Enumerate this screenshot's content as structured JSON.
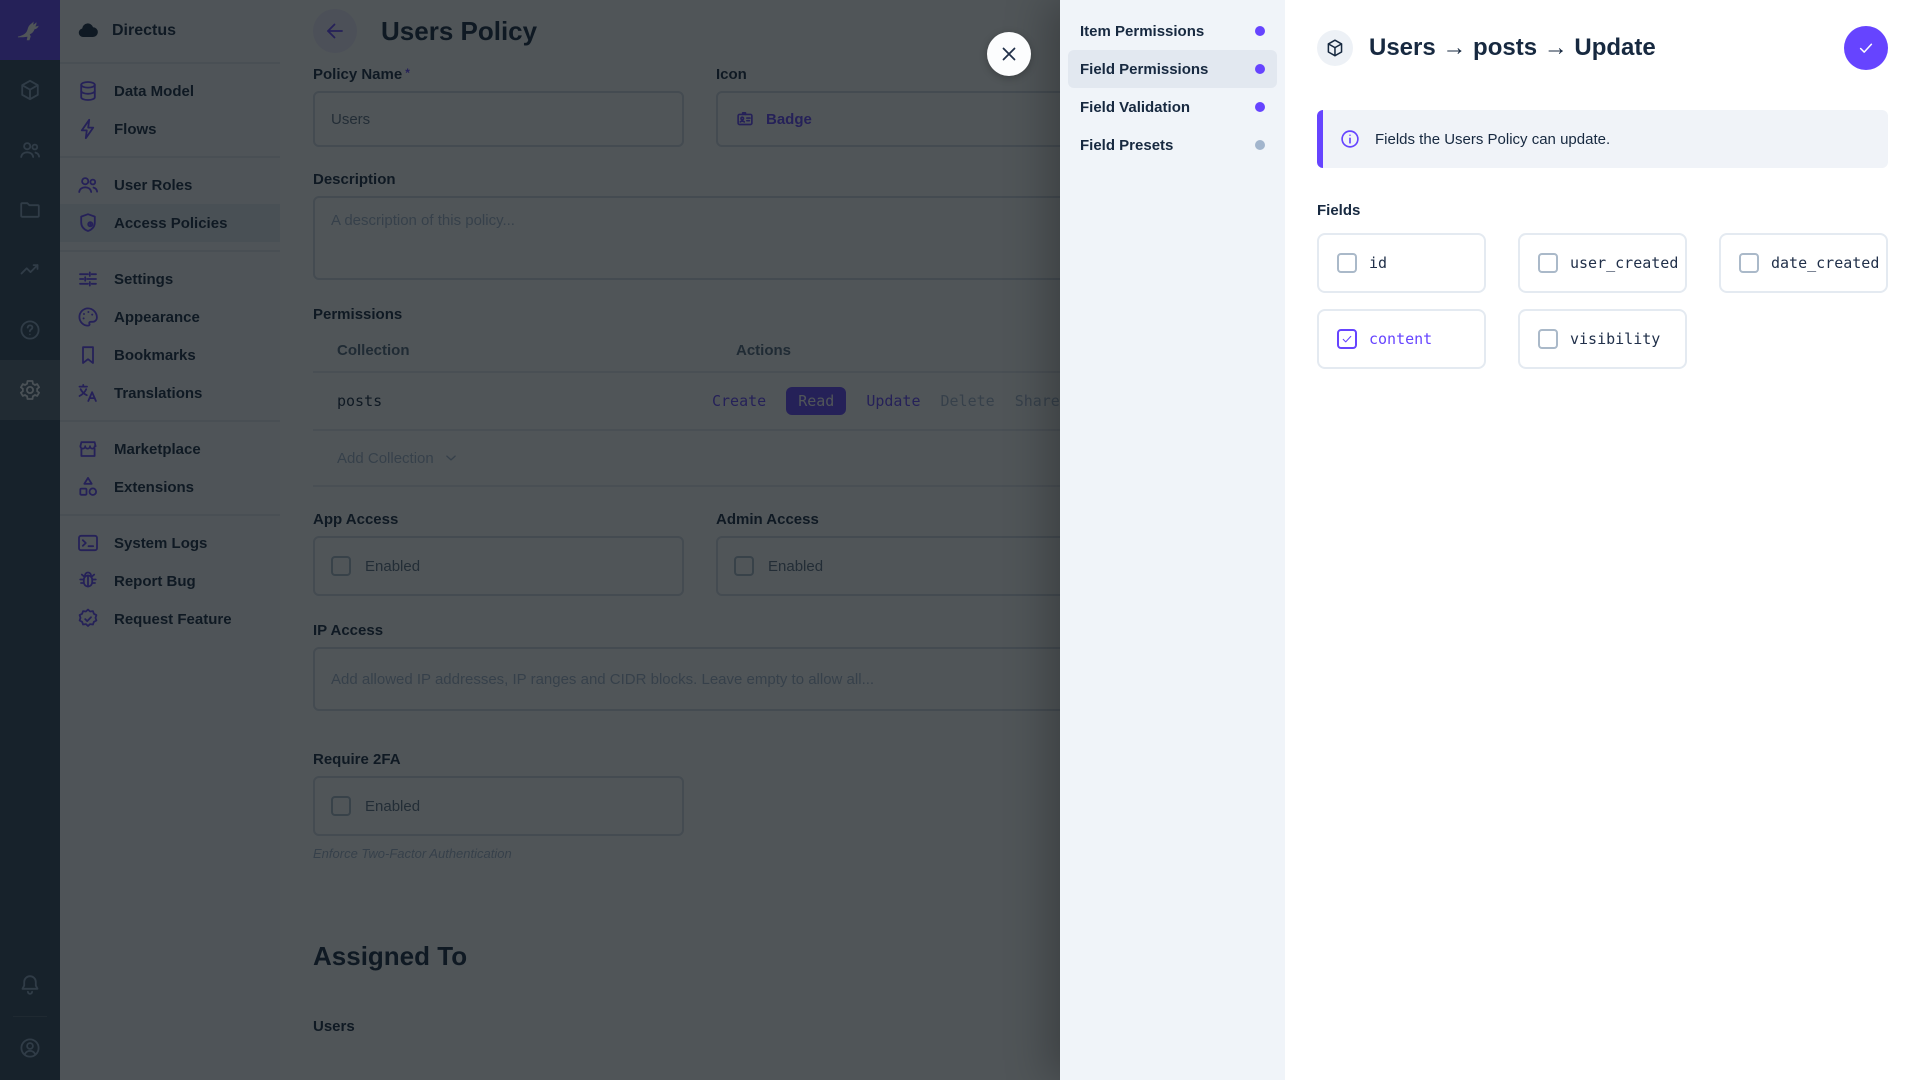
{
  "colors": {
    "accent": "#6644FF",
    "muted_dot": "#A2B5CD"
  },
  "module_bar": {
    "logo_icon": "rabbit-logo-icon",
    "modules": [
      {
        "name": "content",
        "icon": "box-icon"
      },
      {
        "name": "users",
        "icon": "people-icon"
      },
      {
        "name": "files",
        "icon": "folder-icon"
      },
      {
        "name": "insights",
        "icon": "monitoring-icon"
      },
      {
        "name": "docs",
        "icon": "help-icon"
      }
    ],
    "active_module": {
      "name": "settings",
      "icon": "gear-icon"
    },
    "bottom": [
      {
        "name": "notifications",
        "icon": "bell-icon"
      },
      {
        "name": "account",
        "icon": "avatar-icon"
      }
    ]
  },
  "sidebar": {
    "project_name": "Directus",
    "project_icon": "cloud-icon",
    "groups": [
      [
        {
          "label": "Data Model",
          "icon": "database-icon"
        },
        {
          "label": "Flows",
          "icon": "bolt-icon"
        }
      ],
      [
        {
          "label": "User Roles",
          "icon": "people-icon"
        },
        {
          "label": "Access Policies",
          "icon": "shield-icon",
          "active": true
        }
      ],
      [
        {
          "label": "Settings",
          "icon": "tune-icon"
        },
        {
          "label": "Appearance",
          "icon": "palette-icon"
        },
        {
          "label": "Bookmarks",
          "icon": "bookmark-icon"
        },
        {
          "label": "Translations",
          "icon": "translate-icon"
        }
      ],
      [
        {
          "label": "Marketplace",
          "icon": "storefront-icon"
        },
        {
          "label": "Extensions",
          "icon": "category-icon"
        }
      ],
      [
        {
          "label": "System Logs",
          "icon": "terminal-icon"
        },
        {
          "label": "Report Bug",
          "icon": "bug-icon"
        },
        {
          "label": "Request Feature",
          "icon": "verified-icon"
        }
      ]
    ]
  },
  "main": {
    "title": "Users Policy",
    "policy_name": {
      "label": "Policy Name",
      "required_mark": "*",
      "value": "Users"
    },
    "icon_field": {
      "label": "Icon",
      "value": "Badge",
      "icon": "badge-icon"
    },
    "description": {
      "label": "Description",
      "placeholder": "A description of this policy..."
    },
    "permissions": {
      "label": "Permissions",
      "columns": [
        "Collection",
        "Actions"
      ],
      "rows": [
        {
          "collection": "posts",
          "actions": [
            {
              "label": "Create",
              "state": "on"
            },
            {
              "label": "Read",
              "state": "active"
            },
            {
              "label": "Update",
              "state": "on"
            },
            {
              "label": "Delete",
              "state": "off"
            },
            {
              "label": "Share",
              "state": "off"
            }
          ]
        }
      ],
      "add_label": "Add Collection"
    },
    "app_access": {
      "label": "App Access",
      "checkbox_label": "Enabled",
      "checked": false
    },
    "admin_access": {
      "label": "Admin Access",
      "checkbox_label": "Enabled",
      "checked": false
    },
    "ip_access": {
      "label": "IP Access",
      "placeholder": "Add allowed IP addresses, IP ranges and CIDR blocks. Leave empty to allow all..."
    },
    "require_2fa": {
      "label": "Require 2FA",
      "checkbox_label": "Enabled",
      "checked": false,
      "note": "Enforce Two-Factor Authentication"
    },
    "assigned_to": {
      "heading": "Assigned To",
      "sub_label": "Users"
    }
  },
  "drawer": {
    "nav": [
      {
        "label": "Item Permissions",
        "dot": "#6644FF",
        "active": false
      },
      {
        "label": "Field Permissions",
        "dot": "#6644FF",
        "active": true
      },
      {
        "label": "Field Validation",
        "dot": "#6644FF",
        "active": false
      },
      {
        "label": "Field Presets",
        "dot": "#A2B5CD",
        "active": false
      }
    ],
    "title": "Users → posts → Update",
    "title_icon": "box-icon",
    "confirm_icon": "check-icon",
    "notice": {
      "icon": "info-icon",
      "text": "Fields the Users Policy can update."
    },
    "fields_label": "Fields",
    "fields": [
      {
        "label": "id",
        "checked": false
      },
      {
        "label": "user_created",
        "checked": false
      },
      {
        "label": "date_created",
        "checked": false
      },
      {
        "label": "content",
        "checked": true
      },
      {
        "label": "visibility",
        "checked": false
      }
    ]
  }
}
